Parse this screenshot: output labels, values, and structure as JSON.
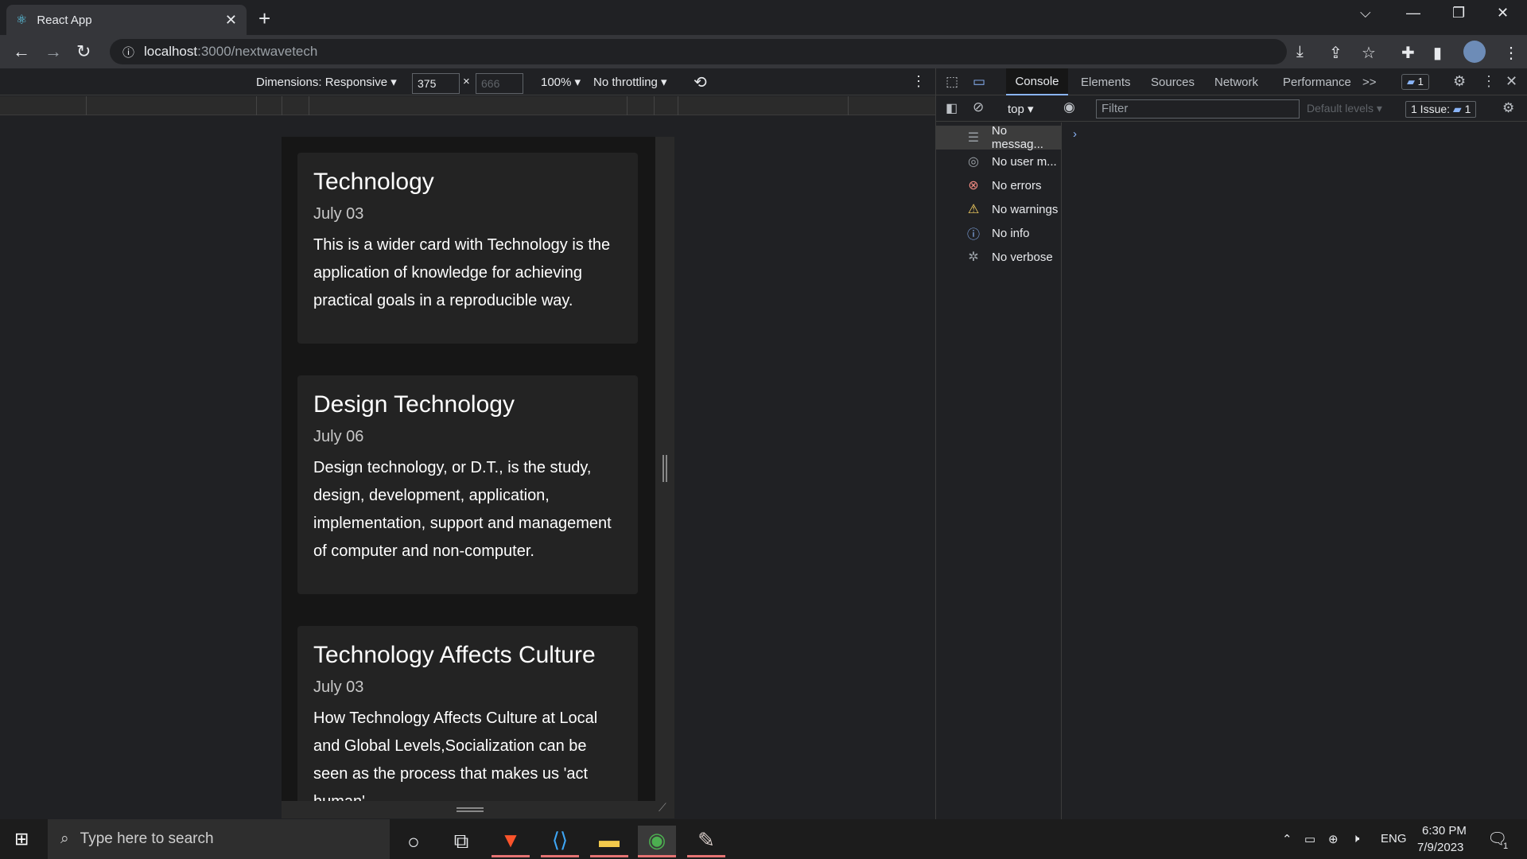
{
  "browser": {
    "tab_title": "React App",
    "tab_close": "✕",
    "new_tab": "+",
    "url_host": "localhost",
    "url_path": ":3000/nextwavetech"
  },
  "device_toolbar": {
    "dimensions": "Dimensions: Responsive ▾",
    "width": "375",
    "times": "×",
    "height": "666",
    "zoom": "100% ▾",
    "throttling": "No throttling ▾"
  },
  "cards": [
    {
      "title": "Technology",
      "date": "July 03",
      "body": "This is a wider card with Technology is the application of knowledge for achieving practical goals in a reproducible way."
    },
    {
      "title": "Design Technology",
      "date": "July 06",
      "body": "Design technology, or D.T., is the study, design, development, application, implementation, support and management of computer and non-computer."
    },
    {
      "title": "Technology Affects Culture",
      "date": "July 03",
      "body": "How Technology Affects Culture at Local and Global Levels,Socialization can be seen as the process that makes us 'act human'"
    }
  ],
  "devtools": {
    "tabs": [
      "Console",
      "Elements",
      "Sources",
      "Network",
      "Performance",
      ">>"
    ],
    "message_badge": "1",
    "context": "top ▾",
    "filter_placeholder": "Filter",
    "levels": "Default levels ▾",
    "issues": "1 Issue:",
    "issues_count": "1",
    "sidebar": [
      {
        "icon": "list-icon",
        "label": "No messag..."
      },
      {
        "icon": "user-icon",
        "label": "No user m..."
      },
      {
        "icon": "error-icon",
        "label": "No errors"
      },
      {
        "icon": "warning-icon",
        "label": "No warnings"
      },
      {
        "icon": "info-icon",
        "label": "No info"
      },
      {
        "icon": "bug-icon",
        "label": "No verbose"
      }
    ]
  },
  "taskbar": {
    "search_placeholder": "Type here to search",
    "language": "ENG",
    "time": "6:30 PM",
    "date": "7/9/2023",
    "notifications": "1"
  }
}
